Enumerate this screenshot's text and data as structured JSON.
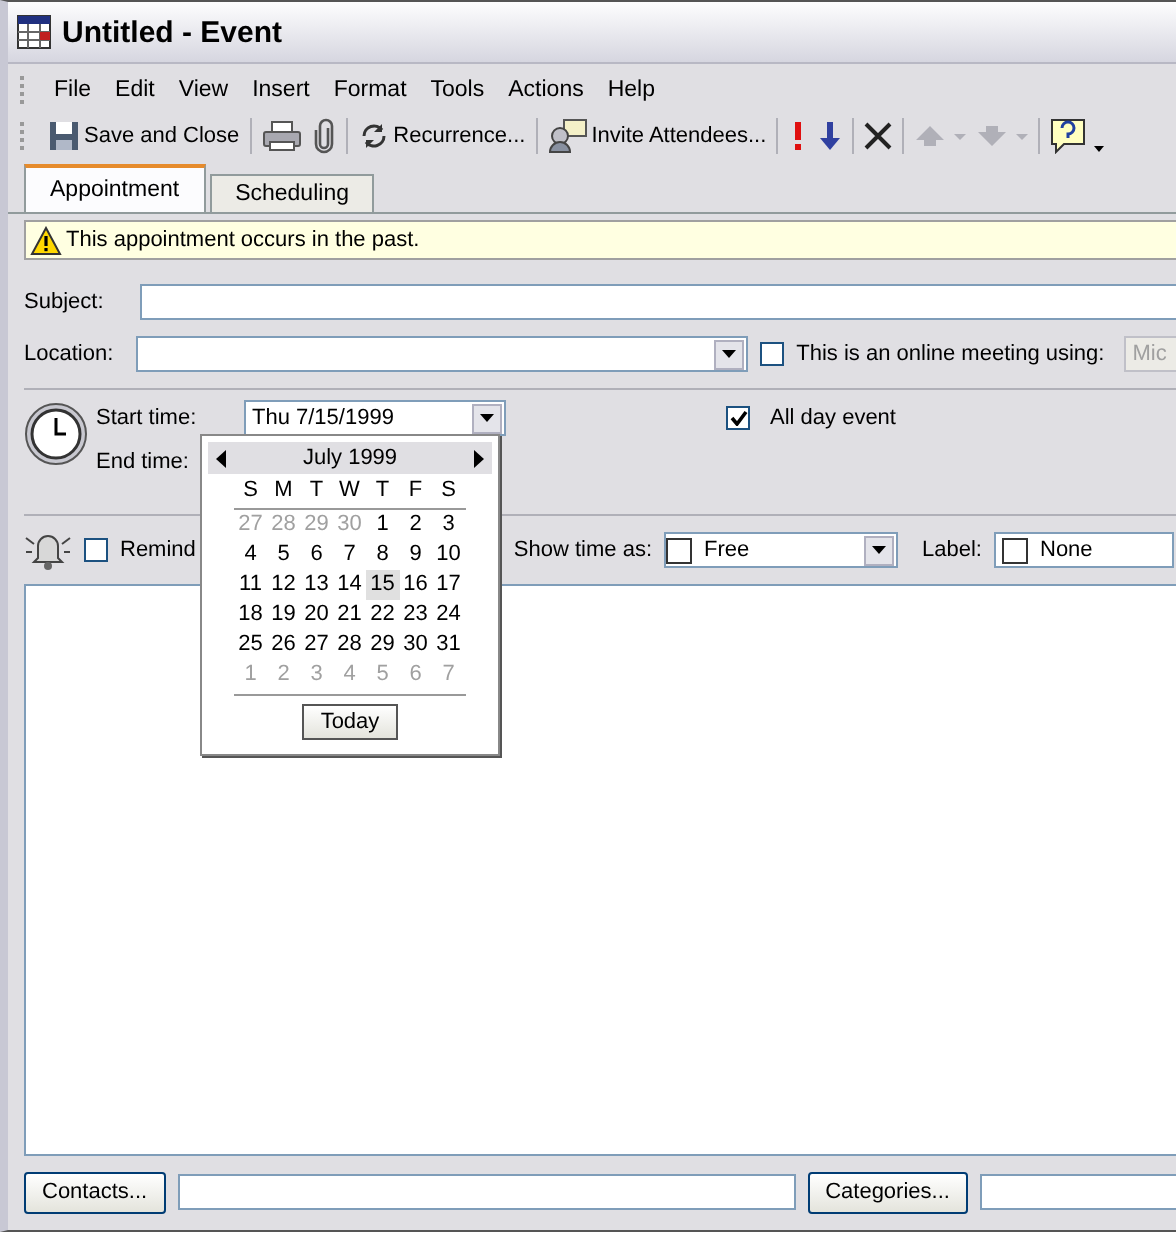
{
  "window": {
    "title": "Untitled - Event"
  },
  "menu": [
    "File",
    "Edit",
    "View",
    "Insert",
    "Format",
    "Tools",
    "Actions",
    "Help"
  ],
  "toolbar": [
    {
      "kind": "save",
      "label": "Save and Close"
    },
    {
      "kind": "separator"
    },
    {
      "kind": "print"
    },
    {
      "kind": "attach"
    },
    {
      "kind": "separator"
    },
    {
      "kind": "recurrence",
      "label": "Recurrence..."
    },
    {
      "kind": "separator"
    },
    {
      "kind": "invite",
      "label": "Invite Attendees..."
    },
    {
      "kind": "separator"
    },
    {
      "kind": "high-importance"
    },
    {
      "kind": "low-importance"
    },
    {
      "kind": "separator"
    },
    {
      "kind": "delete"
    },
    {
      "kind": "separator"
    },
    {
      "kind": "previous",
      "disabled": true
    },
    {
      "kind": "next",
      "disabled": true
    },
    {
      "kind": "separator"
    },
    {
      "kind": "help"
    }
  ],
  "tabs": [
    {
      "label": "Appointment",
      "selected": true
    },
    {
      "label": "Scheduling",
      "selected": false
    }
  ],
  "info_bar": {
    "text": "This appointment occurs in the past."
  },
  "subject": {
    "label": "Subject:"
  },
  "location": {
    "label": "Location:"
  },
  "online_meeting": {
    "label": "This is an online meeting using:",
    "checked": false,
    "value": "Mic",
    "disabled": true
  },
  "start_time": {
    "label": "Start time:",
    "date": "Thu 7/15/1999"
  },
  "all_day": {
    "label": "All day event",
    "checked": true
  },
  "end_time": {
    "label": "End time:"
  },
  "reminder": {
    "label": "Remind",
    "checked": false
  },
  "show_time_as": {
    "label": "Show time as:",
    "value": "Free"
  },
  "label_field": {
    "label": "Label:",
    "value": "None"
  },
  "calendar": {
    "month": "July 1999",
    "weekdays": [
      "S",
      "M",
      "T",
      "W",
      "T",
      "F",
      "S"
    ],
    "weeks": [
      [
        {
          "day": "27",
          "other_month": true,
          "selected": false
        },
        {
          "day": "28",
          "other_month": true,
          "selected": false
        },
        {
          "day": "29",
          "other_month": true,
          "selected": false
        },
        {
          "day": "30",
          "other_month": true,
          "selected": false
        },
        {
          "day": "1",
          "other_month": false,
          "selected": false
        },
        {
          "day": "2",
          "other_month": false,
          "selected": false
        },
        {
          "day": "3",
          "other_month": false,
          "selected": false
        }
      ],
      [
        {
          "day": "4",
          "other_month": false,
          "selected": false
        },
        {
          "day": "5",
          "other_month": false,
          "selected": false
        },
        {
          "day": "6",
          "other_month": false,
          "selected": false
        },
        {
          "day": "7",
          "other_month": false,
          "selected": false
        },
        {
          "day": "8",
          "other_month": false,
          "selected": false
        },
        {
          "day": "9",
          "other_month": false,
          "selected": false
        },
        {
          "day": "10",
          "other_month": false,
          "selected": false
        }
      ],
      [
        {
          "day": "11",
          "other_month": false,
          "selected": false
        },
        {
          "day": "12",
          "other_month": false,
          "selected": false
        },
        {
          "day": "13",
          "other_month": false,
          "selected": false
        },
        {
          "day": "14",
          "other_month": false,
          "selected": false
        },
        {
          "day": "15",
          "other_month": false,
          "selected": true
        },
        {
          "day": "16",
          "other_month": false,
          "selected": false
        },
        {
          "day": "17",
          "other_month": false,
          "selected": false
        }
      ],
      [
        {
          "day": "18",
          "other_month": false,
          "selected": false
        },
        {
          "day": "19",
          "other_month": false,
          "selected": false
        },
        {
          "day": "20",
          "other_month": false,
          "selected": false
        },
        {
          "day": "21",
          "other_month": false,
          "selected": false
        },
        {
          "day": "22",
          "other_month": false,
          "selected": false
        },
        {
          "day": "23",
          "other_month": false,
          "selected": false
        },
        {
          "day": "24",
          "other_month": false,
          "selected": false
        }
      ],
      [
        {
          "day": "25",
          "other_month": false,
          "selected": false
        },
        {
          "day": "26",
          "other_month": false,
          "selected": false
        },
        {
          "day": "27",
          "other_month": false,
          "selected": false
        },
        {
          "day": "28",
          "other_month": false,
          "selected": false
        },
        {
          "day": "29",
          "other_month": false,
          "selected": false
        },
        {
          "day": "30",
          "other_month": false,
          "selected": false
        },
        {
          "day": "31",
          "other_month": false,
          "selected": false
        }
      ],
      [
        {
          "day": "1",
          "other_month": true,
          "selected": false
        },
        {
          "day": "2",
          "other_month": true,
          "selected": false
        },
        {
          "day": "3",
          "other_month": true,
          "selected": false
        },
        {
          "day": "4",
          "other_month": true,
          "selected": false
        },
        {
          "day": "5",
          "other_month": true,
          "selected": false
        },
        {
          "day": "6",
          "other_month": true,
          "selected": false
        },
        {
          "day": "7",
          "other_month": true,
          "selected": false
        }
      ]
    ],
    "today_button": "Today"
  },
  "bottom": {
    "contacts_button": "Contacts...",
    "categories_button": "Categories..."
  }
}
